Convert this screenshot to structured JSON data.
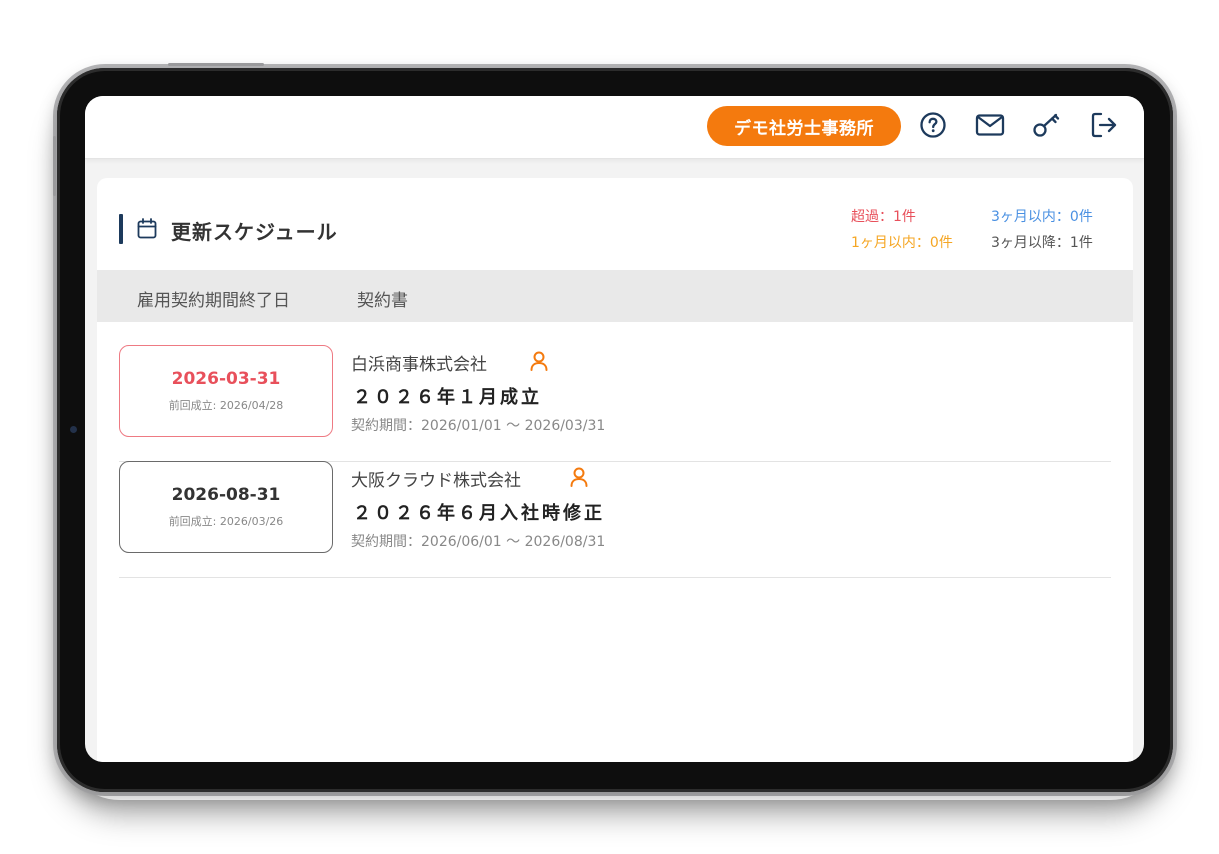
{
  "header": {
    "office_name": "デモ社労士事務所",
    "icons": [
      "help-icon",
      "mail-icon",
      "key-icon",
      "logout-icon"
    ]
  },
  "card": {
    "title": "更新スケジュール",
    "stats": {
      "overdue": "超過：1件",
      "within_1_month": "1ヶ月以内：0件",
      "within_3_months": "3ヶ月以内：0件",
      "after_3_months": "3ヶ月以降：1件"
    },
    "tabs": [
      "雇用契約期間終了日",
      "契約書"
    ],
    "rows": [
      {
        "date": "2026-03-31",
        "previous": "前回成立: 2026/04/28",
        "company": "白浜商事株式会社",
        "contract": "２０２６年１月成立",
        "period": "契約期間：2026/01/01 〜 2026/03/31",
        "status": "overdue"
      },
      {
        "date": "2026-08-31",
        "previous": "前回成立: 2026/03/26",
        "company": "大阪クラウド株式会社",
        "contract": "２０２６年６月入社時修正",
        "period": "契約期間：2026/06/01 〜 2026/08/31",
        "status": "normal"
      }
    ]
  },
  "colors": {
    "accent_orange": "#f47a0e",
    "overdue_red": "#e8505b",
    "within1_orange": "#f5a623",
    "within3_blue": "#4a90e2",
    "after3_gray": "#555555",
    "navy": "#1d3a5c"
  }
}
